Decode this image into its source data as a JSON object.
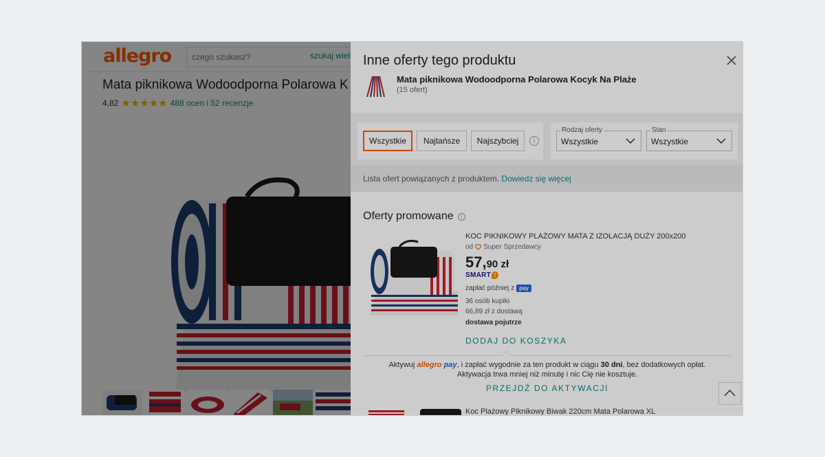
{
  "background_page": {
    "logo": "allegro",
    "search_placeholder": "czego szukasz?",
    "search_button": "szukaj wielu",
    "product_title": "Mata piknikowa Wodoodporna Polarowa K",
    "rating": "4,82",
    "stars": "★★★★★",
    "reviews": "488 ocen i 52 recenzje"
  },
  "panel": {
    "title": "Inne oferty tego produktu",
    "product_name": "Mata piknikowa Wodoodporna Polarowa Kocyk Na Plaże",
    "offer_count": "(15 ofert)",
    "tabs": [
      "Wszystkie",
      "Najtańsze",
      "Najszybciej"
    ],
    "filters": {
      "offer_type": {
        "legend": "Rodzaj oferty",
        "value": "Wszystkie"
      },
      "condition": {
        "legend": "Stan",
        "value": "Wszystkie"
      }
    },
    "note": {
      "text": "Lista ofert powiązanych z produktem.",
      "link": "Dowiedz się więcej"
    },
    "promoted_title": "Oferty promowane",
    "offer": {
      "title": "KOC PIKNIKOWY PLAŻOWY MATA Z IZOLACJĄ DUŻY 200x200",
      "seller_prefix": "od",
      "seller": "Super Sprzedawcy",
      "price_int": "57,",
      "price_dec": "90 zł",
      "smart": "SMART",
      "pay_later": "zapłać później z",
      "pay_badge": "pay",
      "bought": "36 osób kupiło",
      "with_delivery": "66,89 zł z dostawą",
      "delivery": "dostawa pojutrze",
      "add_to_cart": "DODAJ DO KOSZYKA"
    },
    "activate": {
      "prefix": "Aktywuj",
      "logo_allegro": "allegro",
      "logo_pay": "pay",
      "text_a": ", i zapłać wygodnie za ten produkt w ciągu",
      "days": "30 dni",
      "text_b": ", bez dodatkowych opłat. Aktywacja trwa mniej niż minutę i nic Cię nie kosztuje.",
      "link": "PRZEJDŹ DO AKTYWACJI"
    },
    "offer2_title": "Koc Plażowy Piknikowy Biwak 220cm Mata Polarowa XL"
  },
  "colors": {
    "accent": "#ff5a00",
    "link": "#0a8a80",
    "pay_blue": "#2a63d4"
  }
}
